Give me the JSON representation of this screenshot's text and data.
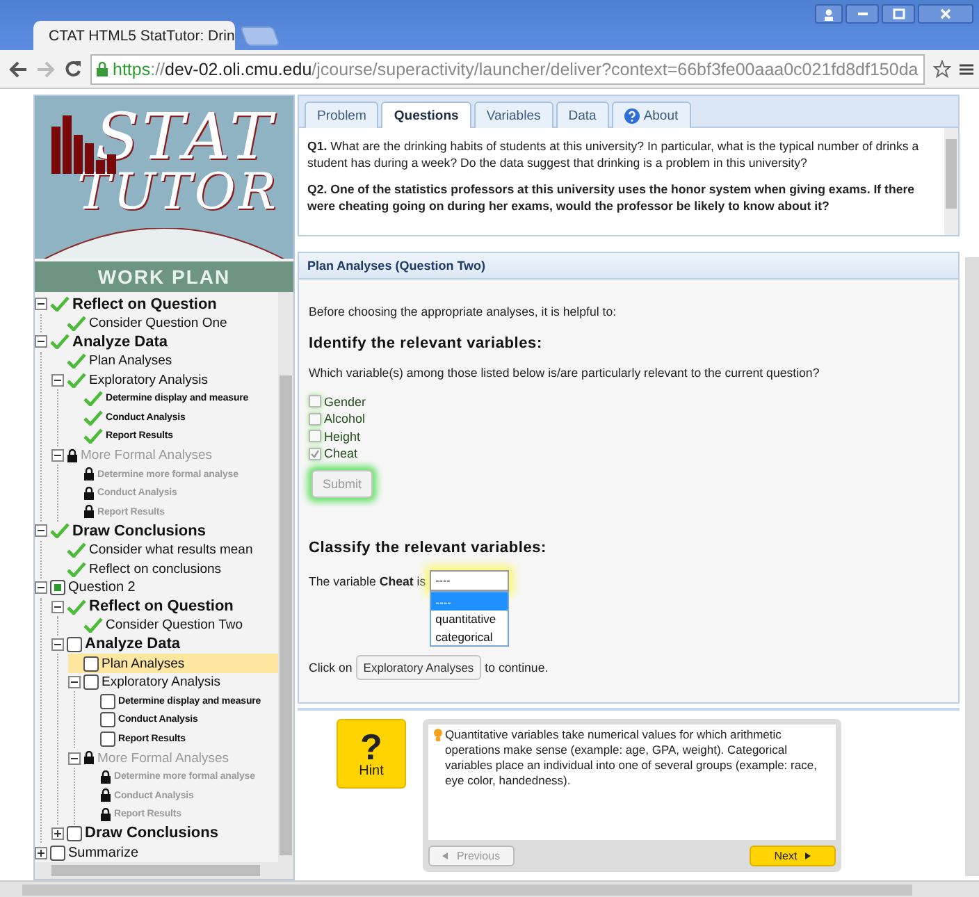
{
  "browser": {
    "tab_title": "CTAT HTML5 StatTutor: Drin",
    "url": {
      "scheme": "https",
      "separator": "://",
      "host": "dev-02.oli.cmu.edu",
      "path": "/jcourse/superactivity/launcher/deliver?context=66bf3fe00aaa0c021fd8df150da"
    }
  },
  "sidebar": {
    "logo": {
      "line_1": "STAT",
      "line_2": "TUTOR",
      "banner": "WORK PLAN"
    },
    "tree": [
      {
        "children": [
          {
            "label": "Reflect on Question",
            "kind": "done",
            "expanded": true,
            "selected": false,
            "children": [
              {
                "label": "Consider Question One",
                "kind": "done",
                "selected": false
              }
            ]
          },
          {
            "label": "Analyze Data",
            "kind": "done",
            "expanded": true,
            "selected": false,
            "children": [
              {
                "label": "Plan Analyses",
                "kind": "done",
                "selected": false
              },
              {
                "label": "Exploratory Analysis",
                "kind": "done",
                "expanded": true,
                "selected": false,
                "children": [
                  {
                    "label": "Determine display and measure",
                    "kind": "done",
                    "selected": false
                  },
                  {
                    "label": "Conduct Analysis",
                    "kind": "done",
                    "selected": false
                  },
                  {
                    "label": "Report Results",
                    "kind": "done",
                    "selected": false
                  }
                ]
              },
              {
                "label": "More Formal Analyses",
                "kind": "locked",
                "expanded": true,
                "selected": false,
                "children": [
                  {
                    "label": "Determine more formal analyse",
                    "kind": "locked",
                    "selected": false
                  },
                  {
                    "label": "Conduct Analysis",
                    "kind": "locked",
                    "selected": false
                  },
                  {
                    "label": "Report Results",
                    "kind": "locked",
                    "selected": false
                  }
                ]
              }
            ]
          },
          {
            "label": "Draw Conclusions",
            "kind": "done",
            "expanded": true,
            "selected": false,
            "children": [
              {
                "label": "Consider what results mean",
                "kind": "done",
                "selected": false
              },
              {
                "label": "Reflect on conclusions",
                "kind": "done",
                "selected": false
              }
            ]
          }
        ]
      },
      {
        "label": "Question 2",
        "kind": "current",
        "expanded": true,
        "selected": false,
        "children": [
          {
            "label": "Reflect on Question",
            "kind": "done",
            "expanded": true,
            "selected": false,
            "children": [
              {
                "label": "Consider Question Two",
                "kind": "done",
                "selected": false
              }
            ]
          },
          {
            "label": "Analyze Data",
            "kind": "open",
            "expanded": true,
            "selected": false,
            "children": [
              {
                "label": "Plan Analyses",
                "kind": "open",
                "selected": true
              },
              {
                "label": "Exploratory Analysis",
                "kind": "open",
                "expanded": true,
                "selected": false,
                "children": [
                  {
                    "label": "Determine display and measure",
                    "kind": "open",
                    "selected": false
                  },
                  {
                    "label": "Conduct Analysis",
                    "kind": "open",
                    "selected": false
                  },
                  {
                    "label": "Report Results",
                    "kind": "open",
                    "selected": false
                  }
                ]
              },
              {
                "label": "More Formal Analyses",
                "kind": "locked",
                "expanded": true,
                "selected": false,
                "children": [
                  {
                    "label": "Determine more formal analyse",
                    "kind": "locked",
                    "selected": false
                  },
                  {
                    "label": "Conduct Analysis",
                    "kind": "locked",
                    "selected": false
                  },
                  {
                    "label": "Report Results",
                    "kind": "locked",
                    "selected": false
                  }
                ]
              }
            ]
          },
          {
            "label": "Draw Conclusions",
            "kind": "open",
            "expanded": false,
            "selected": false
          }
        ]
      },
      {
        "label": "Summarize",
        "kind": "open",
        "expanded": false,
        "selected": false
      }
    ]
  },
  "tabs": [
    {
      "label": "Problem",
      "kind": "plain",
      "selected": false
    },
    {
      "label": "Questions",
      "kind": "plain",
      "selected": true
    },
    {
      "label": "Variables",
      "kind": "plain",
      "selected": false
    },
    {
      "label": "Data",
      "kind": "plain",
      "selected": false
    },
    {
      "label": "About",
      "kind": "help",
      "selected": false
    }
  ],
  "questions": [
    {
      "text": "**Q1.** What are the drinking habits of students at this university? In particular, what is the typical number of drinks a student has during a week? Do the data suggest that drinking is a problem in this university?",
      "bold": false
    },
    {
      "text": "Q2. One of the statistics professors at this university uses the honor system when giving exams. If there were cheating going on during her exams, would the professor be likely to know about it?",
      "bold": true
    }
  ],
  "plan": {
    "title": "Plan Analyses (Question Two)",
    "intro": "Before choosing the appropriate analyses, it is helpful to:",
    "identify": {
      "heading": "Identify the relevant variables:",
      "prompt": "Which variable(s) among those listed below is/are particularly relevant to the current question?",
      "options": [
        {
          "label": "Gender",
          "checked": false
        },
        {
          "label": "Alcohol",
          "checked": false
        },
        {
          "label": "Height",
          "checked": false
        },
        {
          "label": "Cheat",
          "checked": true
        }
      ],
      "correct": true,
      "submit": {
        "label": "Submit",
        "disabled": true
      }
    },
    "classify": {
      "heading": "Classify the relevant variables:",
      "sentence": "The variable **Cheat** is",
      "select": {
        "value": "----",
        "expanded": true,
        "options": [
          {
            "label": "----",
            "selected": true
          },
          {
            "label": "quantitative",
            "selected": false
          },
          {
            "label": "categorical",
            "selected": false
          }
        ]
      }
    },
    "continue": {
      "before": "Click on",
      "button": "Exploratory Analyses",
      "after": "to continue."
    }
  },
  "hint": {
    "symbol": "?",
    "label": "Hint",
    "message": "Quantitative variables take numerical values for which arithmetic operations make sense (example: age, GPA, weight). Categorical variables place an individual into one of several groups (example: race, eye color, handedness).",
    "previous": {
      "label": "Previous",
      "disabled": true
    },
    "next": {
      "label": "Next",
      "disabled": false
    }
  }
}
